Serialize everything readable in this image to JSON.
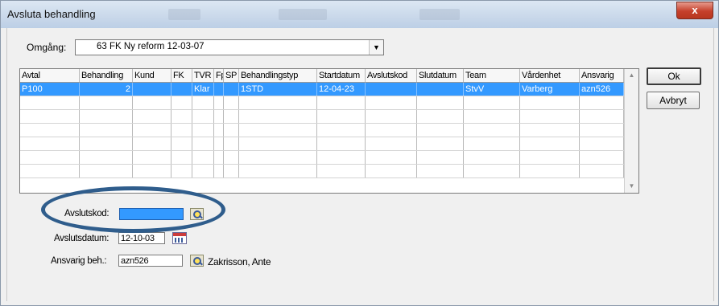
{
  "window": {
    "title": "Avsluta behandling",
    "close_glyph": "x"
  },
  "omgang": {
    "label": "Omgång:",
    "value": "63 FK Ny reform  12-03-07",
    "arrow": "▼"
  },
  "table": {
    "columns": [
      "Avtal",
      "Behandling",
      "Kund",
      "FK",
      "TVR",
      "Fp",
      "SP",
      "Behandlingstyp",
      "Startdatum",
      "Avslutskod",
      "Slutdatum",
      "Team",
      "Vårdenhet",
      "Ansvarig"
    ],
    "rows": [
      [
        "P100",
        "2",
        "",
        "",
        "Klar",
        "",
        "",
        "1STD",
        "12-04-23",
        "",
        "",
        "StvV",
        "Varberg",
        "azn526"
      ]
    ],
    "empty_rows": 6,
    "scroll_up": "▲",
    "scroll_down": "▼"
  },
  "buttons": {
    "ok": "Ok",
    "cancel": "Avbryt"
  },
  "form": {
    "avslutskod_label": "Avslutskod:",
    "avslutskod_value": "",
    "avslutsdatum_label": "Avslutsdatum:",
    "avslutsdatum_value": "12-10-03",
    "ansvarig_label": "Ansvarig beh.:",
    "ansvarig_value": "azn526",
    "ansvarig_name": "Zakrisson, Ante"
  },
  "colors": {
    "selection": "#3399ff",
    "highlight_ellipse": "#2f5d8c",
    "close_button": "#c5402b"
  }
}
